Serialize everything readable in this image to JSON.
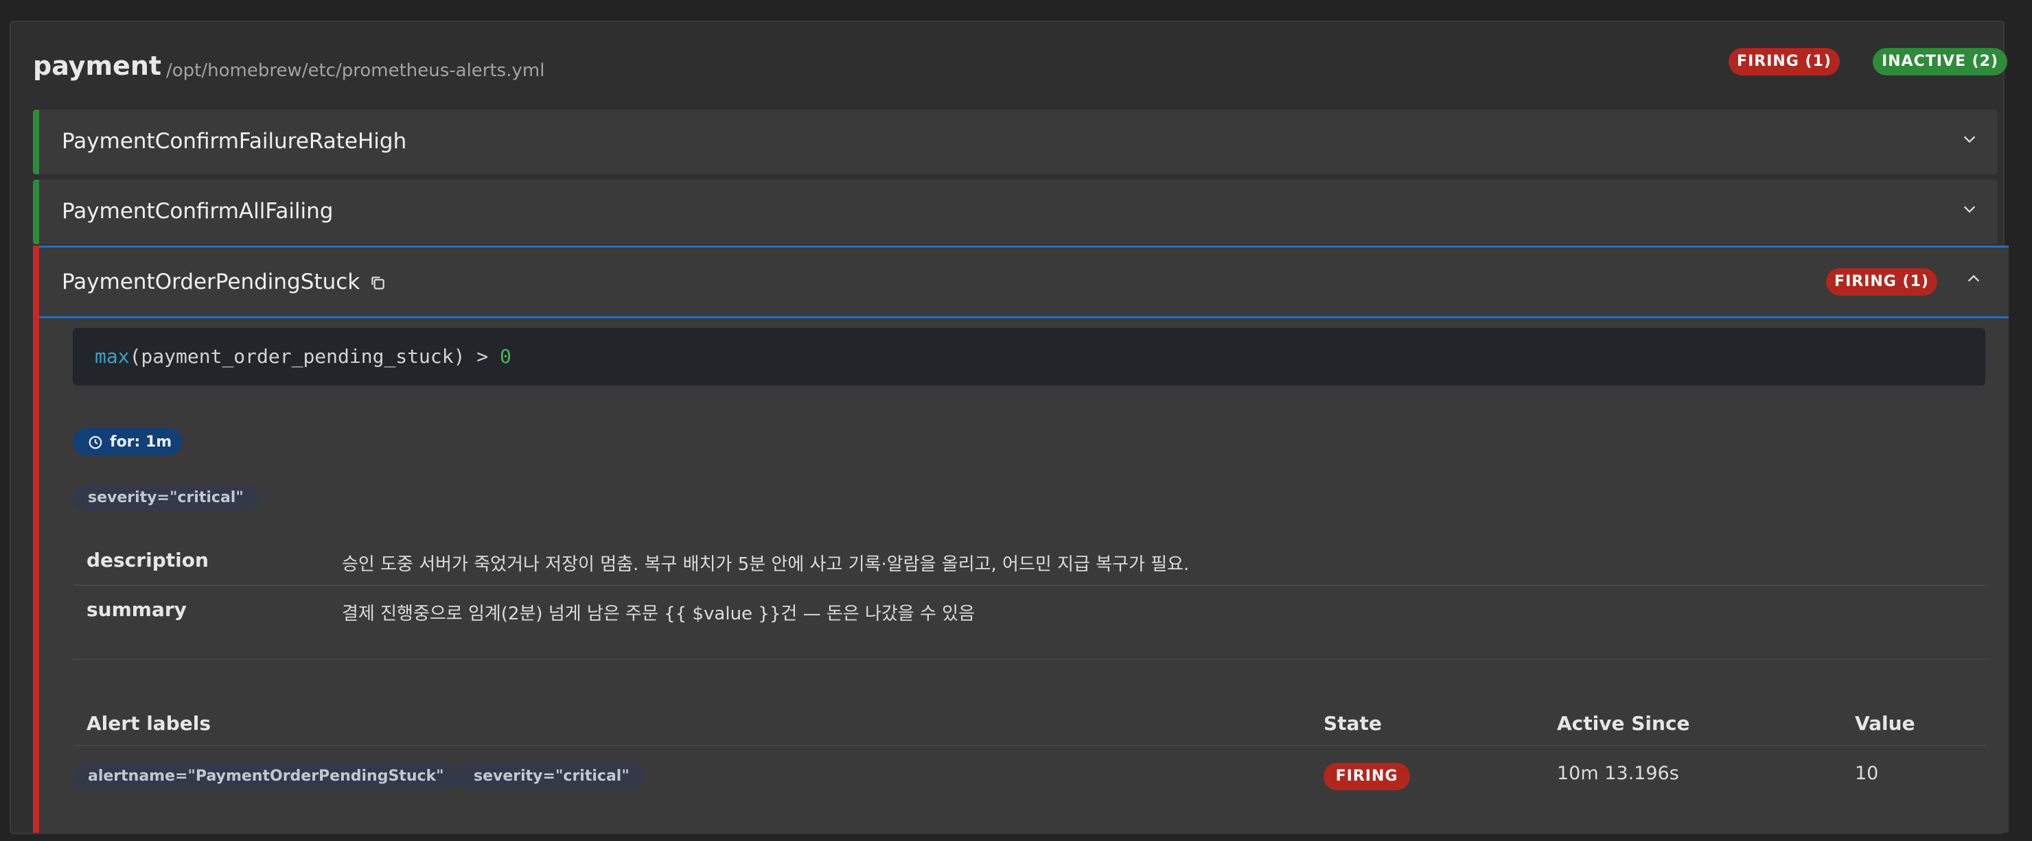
{
  "group": {
    "title": "payment",
    "file": "/opt/homebrew/etc/prometheus-alerts.yml",
    "firing_badge": "FIRING (1)",
    "inactive_badge": "INACTIVE (2)"
  },
  "rules": [
    {
      "name": "PaymentConfirmFailureRateHigh"
    },
    {
      "name": "PaymentConfirmAllFailing"
    },
    {
      "name": "PaymentOrderPendingStuck",
      "badge": "FIRING (1)"
    }
  ],
  "expanded_rule": {
    "query_fn": "max",
    "query_body": "(payment_order_pending_stuck) > ",
    "query_num": "0",
    "for_label": "for: 1m",
    "labels": [
      "severity=\"critical\""
    ],
    "annotations": [
      {
        "key": "description",
        "value": "승인 도중 서버가 죽었거나 저장이 멈춤. 복구 배치가 5분 안에 사고 기록·알람을 올리고, 어드민 지급 복구가 필요."
      },
      {
        "key": "summary",
        "value": "결제 진행중으로 임계(2분) 넘게 남은 주문 {{ $value }}건 — 돈은 나갔을 수 있음"
      }
    ],
    "alerts_table": {
      "headers": {
        "labels": "Alert labels",
        "state": "State",
        "active_since": "Active Since",
        "value": "Value"
      },
      "rows": [
        {
          "labels": [
            "alertname=\"PaymentOrderPendingStuck\"",
            "severity=\"critical\""
          ],
          "state": "FIRING",
          "active_since": "10m 13.196s",
          "value": "10"
        }
      ]
    }
  },
  "colors": {
    "firing": "#b3261e",
    "inactive": "#2e8b3a",
    "accent": "#1f6fcf",
    "pill": "#123f75"
  }
}
